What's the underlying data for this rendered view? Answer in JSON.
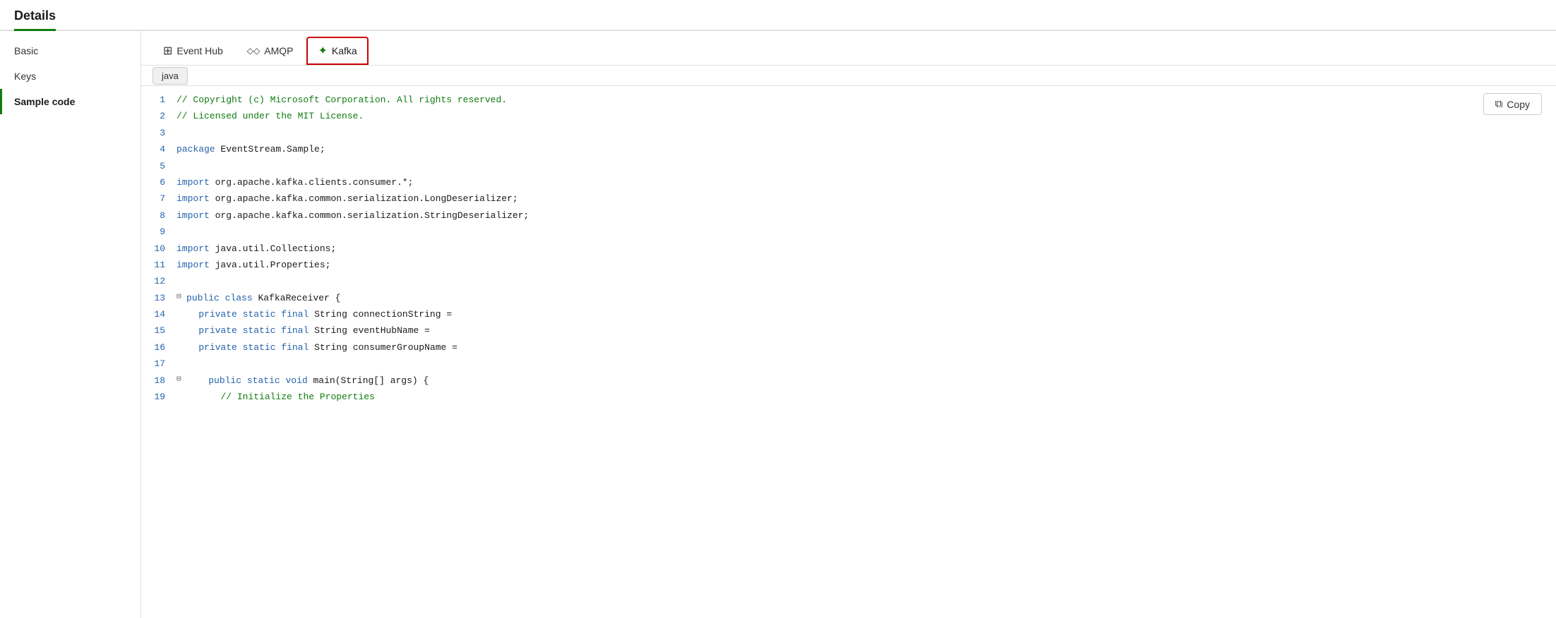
{
  "page": {
    "title": "Details"
  },
  "tabs": [
    {
      "id": "event-hub",
      "label": "Event Hub",
      "icon": "⊞",
      "active": false
    },
    {
      "id": "amqp",
      "label": "AMQP",
      "icon": "◇◇",
      "active": false
    },
    {
      "id": "kafka",
      "label": "Kafka",
      "icon": "✦",
      "active": true
    }
  ],
  "sidebar": {
    "items": [
      {
        "id": "basic",
        "label": "Basic",
        "active": false
      },
      {
        "id": "keys",
        "label": "Keys",
        "active": false
      },
      {
        "id": "sample-code",
        "label": "Sample code",
        "active": true
      }
    ]
  },
  "language": {
    "badge": "java"
  },
  "copy_button": {
    "label": "Copy",
    "icon": "copy"
  },
  "code": {
    "lines": [
      {
        "num": 1,
        "content": "// Copyright (c) Microsoft Corporation. All rights reserved.",
        "type": "comment",
        "fold": false
      },
      {
        "num": 2,
        "content": "// Licensed under the MIT License.",
        "type": "comment",
        "fold": false
      },
      {
        "num": 3,
        "content": "",
        "type": "plain",
        "fold": false
      },
      {
        "num": 4,
        "content": "package EventStream.Sample;",
        "type": "package",
        "fold": false
      },
      {
        "num": 5,
        "content": "",
        "type": "plain",
        "fold": false
      },
      {
        "num": 6,
        "content": "import org.apache.kafka.clients.consumer.*;",
        "type": "import",
        "fold": false
      },
      {
        "num": 7,
        "content": "import org.apache.kafka.common.serialization.LongDeserializer;",
        "type": "import",
        "fold": false
      },
      {
        "num": 8,
        "content": "import org.apache.kafka.common.serialization.StringDeserializer;",
        "type": "import",
        "fold": false
      },
      {
        "num": 9,
        "content": "",
        "type": "plain",
        "fold": false
      },
      {
        "num": 10,
        "content": "import java.util.Collections;",
        "type": "import",
        "fold": false
      },
      {
        "num": 11,
        "content": "import java.util.Properties;",
        "type": "import",
        "fold": false
      },
      {
        "num": 12,
        "content": "",
        "type": "plain",
        "fold": false
      },
      {
        "num": 13,
        "content": "public class KafkaReceiver {",
        "type": "class",
        "fold": true
      },
      {
        "num": 14,
        "content": "    private static final String connectionString =",
        "type": "field",
        "fold": false
      },
      {
        "num": 15,
        "content": "    private static final String eventHubName =",
        "type": "field",
        "fold": false
      },
      {
        "num": 16,
        "content": "    private static final String consumerGroupName =",
        "type": "field",
        "fold": false
      },
      {
        "num": 17,
        "content": "",
        "type": "plain",
        "fold": false
      },
      {
        "num": 18,
        "content": "    public static void main(String[] args) {",
        "type": "method",
        "fold": true
      },
      {
        "num": 19,
        "content": "        // Initialize the Properties",
        "type": "inner-comment",
        "fold": false
      }
    ]
  }
}
